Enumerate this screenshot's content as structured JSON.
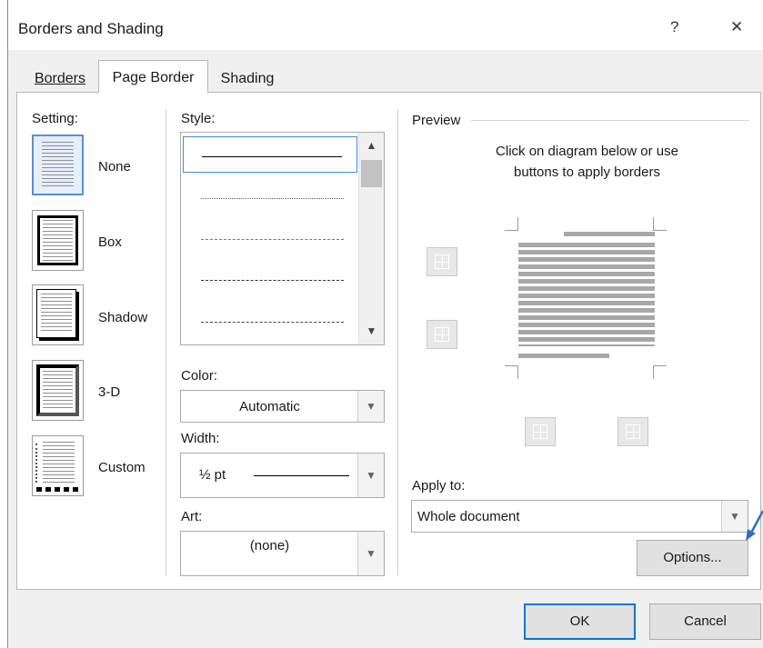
{
  "window": {
    "title": "Borders and Shading",
    "help_label": "?",
    "close_label": "✕"
  },
  "tabs": [
    {
      "label": "Borders",
      "access_key_index": 0
    },
    {
      "label": "Page Border"
    },
    {
      "label": "Shading",
      "access_key_index": 0
    }
  ],
  "setting": {
    "label": "Setting:",
    "items": [
      {
        "name": "None",
        "selected": true
      },
      {
        "name": "Box"
      },
      {
        "name": "Shadow"
      },
      {
        "name": "3-D"
      },
      {
        "name": "Custom"
      }
    ]
  },
  "style": {
    "label": "Style:"
  },
  "color": {
    "label": "Color:",
    "value": "Automatic"
  },
  "width": {
    "label": "Width:",
    "value": "½ pt"
  },
  "art": {
    "label": "Art:",
    "value": "(none)"
  },
  "preview": {
    "label": "Preview",
    "instruction_line1": "Click on diagram below or use",
    "instruction_line2": "buttons to apply borders"
  },
  "apply_to": {
    "label": "Apply to:",
    "value": "Whole document"
  },
  "buttons": {
    "options": "Options...",
    "ok": "OK",
    "cancel": "Cancel"
  },
  "colors": {
    "accent": "#5a8fd6",
    "focus": "#0078d7",
    "arrow": "#2f6fc4"
  },
  "icons": [
    "help-icon",
    "close-icon",
    "scroll-up-icon",
    "scroll-down-icon",
    "chevron-down-icon",
    "border-top-icon",
    "border-bottom-icon",
    "border-left-icon",
    "border-right-icon",
    "pointer-arrow-icon"
  ]
}
